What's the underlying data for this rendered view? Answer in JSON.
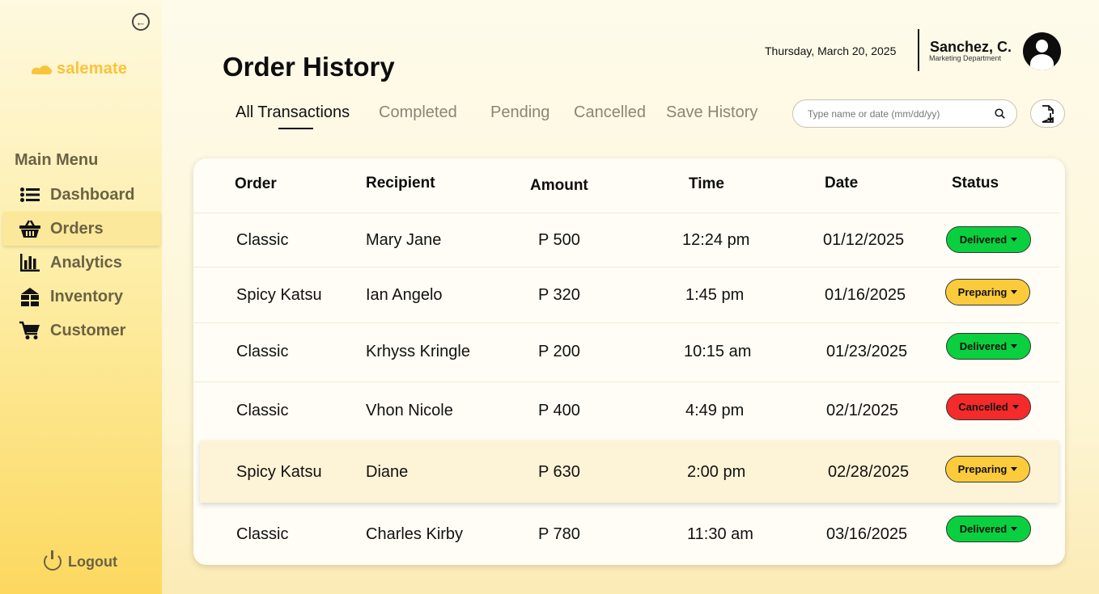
{
  "app": {
    "logo_text": "salemate",
    "brand_color": "#f9c33a"
  },
  "sidebar": {
    "menu_title": "Main Menu",
    "items": [
      {
        "label": "Dashboard",
        "icon": "list-icon",
        "active": false
      },
      {
        "label": "Orders",
        "icon": "basket-icon",
        "active": true
      },
      {
        "label": "Analytics",
        "icon": "bar-chart-icon",
        "active": false
      },
      {
        "label": "Inventory",
        "icon": "warehouse-icon",
        "active": false
      },
      {
        "label": "Customer",
        "icon": "cart-icon",
        "active": false
      }
    ],
    "logout_label": "Logout"
  },
  "header": {
    "title": "Order History",
    "date": "Thursday, March 20, 2025",
    "user_name": "Sanchez, C.",
    "user_department": "Marketing Department"
  },
  "tabs": [
    "All Transactions",
    "Completed",
    "Pending",
    "Cancelled",
    "Save History"
  ],
  "active_tab": "All Transactions",
  "search": {
    "placeholder": "Type name or date (mm/dd/yy)"
  },
  "table": {
    "columns": [
      "Order",
      "Recipient",
      "Amount",
      "Time",
      "Date",
      "Status"
    ],
    "rows": [
      {
        "order": "Classic",
        "recipient": "Mary Jane",
        "amount": "P 500",
        "time": "12:24 pm",
        "date": "01/12/2025",
        "status": "Delivered"
      },
      {
        "order": "Spicy Katsu",
        "recipient": "Ian Angelo",
        "amount": "P 320",
        "time": "1:45 pm",
        "date": "01/16/2025",
        "status": "Preparing"
      },
      {
        "order": "Classic",
        "recipient": "Krhyss Kringle",
        "amount": "P 200",
        "time": "10:15 am",
        "date": "01/23/2025",
        "status": "Delivered"
      },
      {
        "order": "Classic",
        "recipient": "Vhon Nicole",
        "amount": "P 400",
        "time": "4:49 pm",
        "date": "02/1/2025",
        "status": "Cancelled"
      },
      {
        "order": "Spicy Katsu",
        "recipient": "Diane",
        "amount": "P 630",
        "time": "2:00 pm",
        "date": "02/28/2025",
        "status": "Preparing"
      },
      {
        "order": "Classic",
        "recipient": "Charles Kirby",
        "amount": "P 780",
        "time": "11:30 am",
        "date": "03/16/2025",
        "status": "Delivered"
      }
    ]
  },
  "status_colors": {
    "Delivered": "#0ad03f",
    "Preparing": "#fccb3c",
    "Cancelled": "#f52a2a"
  }
}
